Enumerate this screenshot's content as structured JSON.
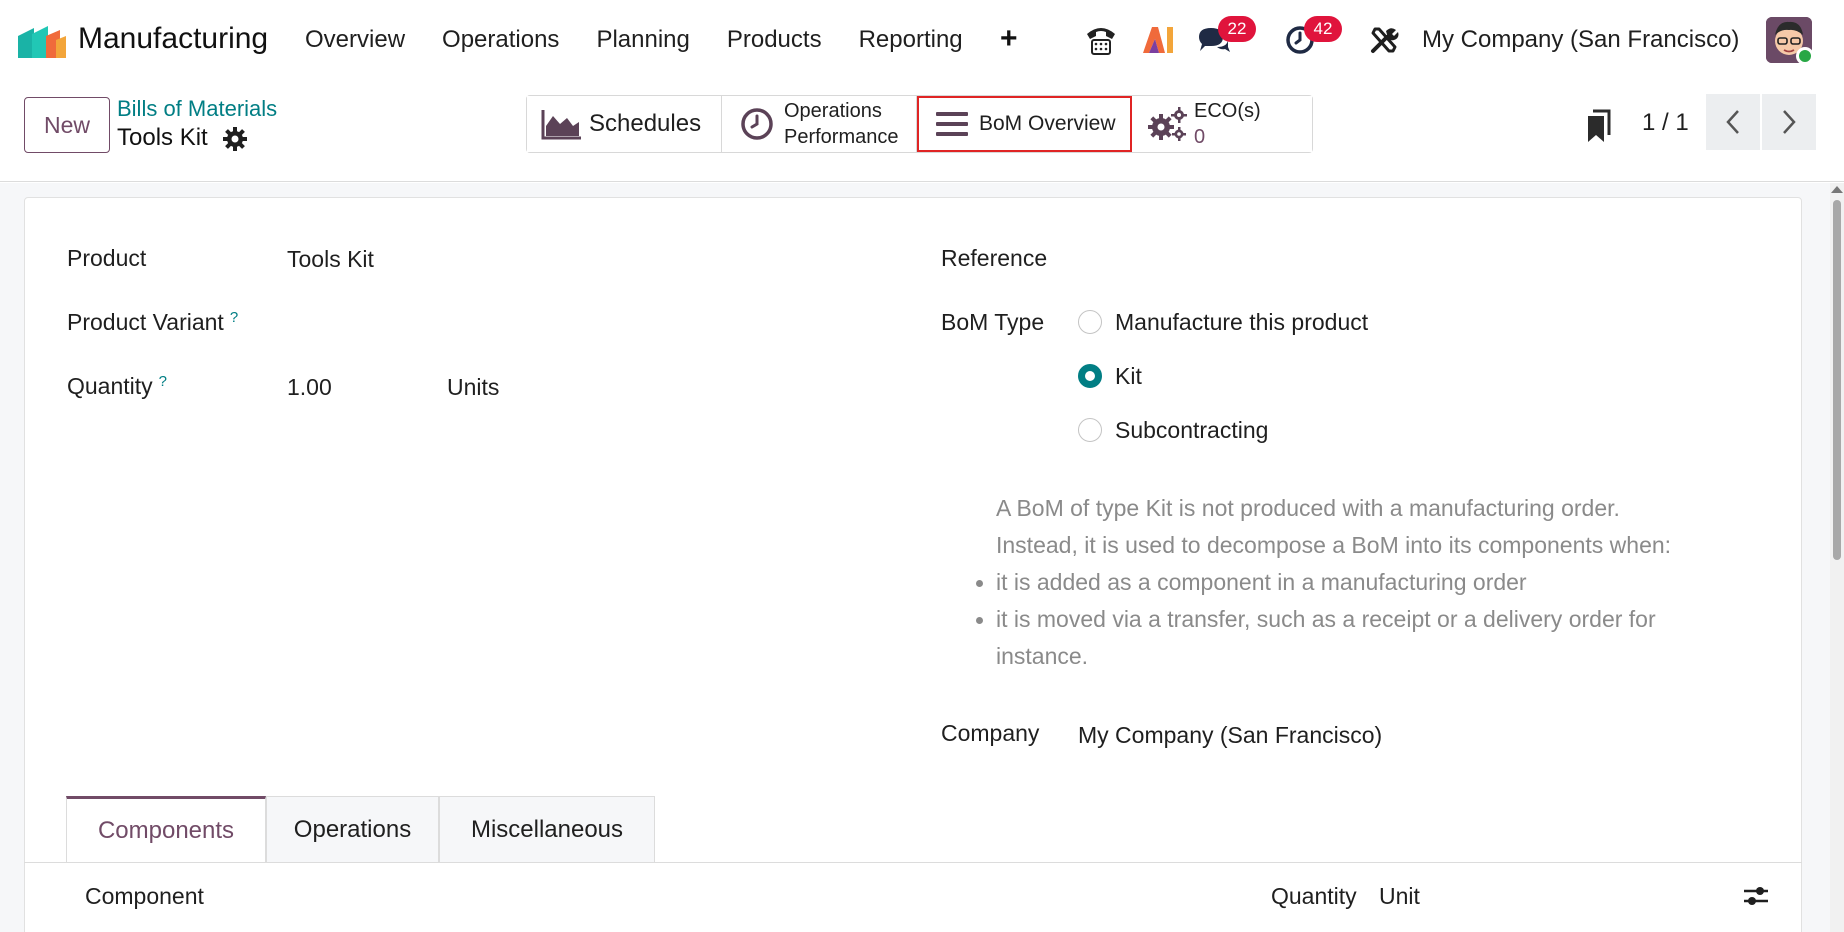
{
  "navbar": {
    "app_name": "Manufacturing",
    "menu": [
      "Overview",
      "Operations",
      "Planning",
      "Products",
      "Reporting"
    ],
    "plus_label": "+",
    "messages_count": "22",
    "activities_count": "42",
    "company": "My Company (San Francisco)"
  },
  "control": {
    "new_label": "New",
    "breadcrumb": "Bills of Materials",
    "record_title": "Tools Kit",
    "smart_buttons": {
      "schedules": "Schedules",
      "operations_performance_1": "Operations",
      "operations_performance_2": "Performance",
      "bom_overview": "BoM Overview",
      "eco_label": "ECO(s)",
      "eco_value": "0"
    },
    "pager": "1 / 1"
  },
  "form": {
    "product_label": "Product",
    "product_value": "Tools Kit",
    "variant_label": "Product Variant",
    "quantity_label": "Quantity",
    "quantity_value": "1.00",
    "quantity_unit": "Units",
    "help_mark": "?",
    "reference_label": "Reference",
    "bom_type_label": "BoM Type",
    "bom_types": [
      "Manufacture this product",
      "Kit",
      "Subcontracting"
    ],
    "bom_type_selected": "Kit",
    "help_line_1": "A BoM of type Kit is not produced with a manufacturing order.",
    "help_line_2": "Instead, it is used to decompose a BoM into its components when:",
    "help_bullet_1": "it is added as a component in a manufacturing order",
    "help_bullet_2a": "it is moved via a transfer, such as a receipt or a delivery order for",
    "help_bullet_2b": "instance.",
    "company_label": "Company",
    "company_value": "My Company (San Francisco)"
  },
  "tabs": [
    "Components",
    "Operations",
    "Miscellaneous"
  ],
  "table": {
    "col_component": "Component",
    "col_quantity": "Quantity",
    "col_unit": "Unit"
  },
  "colors": {
    "brand": "#714b67",
    "accent": "#017e84",
    "badge": "#e0143c",
    "highlight": "#e02424"
  }
}
